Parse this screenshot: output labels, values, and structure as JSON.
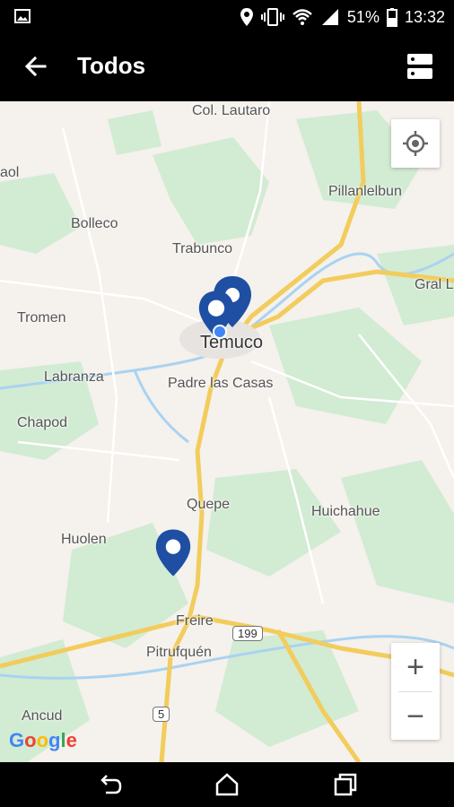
{
  "status_bar": {
    "battery": "51%",
    "time": "13:32",
    "icons": [
      "image-icon",
      "location-icon",
      "vibrate-icon",
      "wifi-icon",
      "signal-icon",
      "battery-icon"
    ]
  },
  "app_bar": {
    "title": "Todos",
    "icons": [
      "back-arrow-icon",
      "layers-icon"
    ]
  },
  "map": {
    "places": [
      {
        "id": "col-lautaro",
        "label": "Col. Lautaro"
      },
      {
        "id": "pillanlelbun",
        "label": "Pillanlelbun"
      },
      {
        "id": "bolleco",
        "label": "Bolleco"
      },
      {
        "id": "trabunco",
        "label": "Trabunco"
      },
      {
        "id": "gral-l",
        "label": "Gral L"
      },
      {
        "id": "tromen",
        "label": "Tromen"
      },
      {
        "id": "temuco",
        "label": "Temuco"
      },
      {
        "id": "labranza",
        "label": "Labranza"
      },
      {
        "id": "padre-las-casas",
        "label": "Padre las Casas"
      },
      {
        "id": "chapod",
        "label": "Chapod"
      },
      {
        "id": "quepe",
        "label": "Quepe"
      },
      {
        "id": "huichahue",
        "label": "Huichahue"
      },
      {
        "id": "huolen",
        "label": "Huolen"
      },
      {
        "id": "freire",
        "label": "Freire"
      },
      {
        "id": "pitrufquen",
        "label": "Pitrufquén"
      },
      {
        "id": "ancud",
        "label": "Ancud"
      },
      {
        "id": "aol",
        "label": "aol"
      }
    ],
    "route_shields": [
      "199",
      "5"
    ],
    "controls": {
      "zoom_in": "+",
      "zoom_out": "−"
    },
    "attribution": "Google",
    "colors": {
      "land": "#f5f1ec",
      "green": "#cdeacd",
      "highway": "#f7d774",
      "water": "#a9d3f2",
      "marker": "#1e4fa3",
      "my_location": "#4285f4"
    }
  },
  "nav_bar": {
    "icons": [
      "back-icon",
      "home-icon",
      "recents-icon"
    ]
  }
}
